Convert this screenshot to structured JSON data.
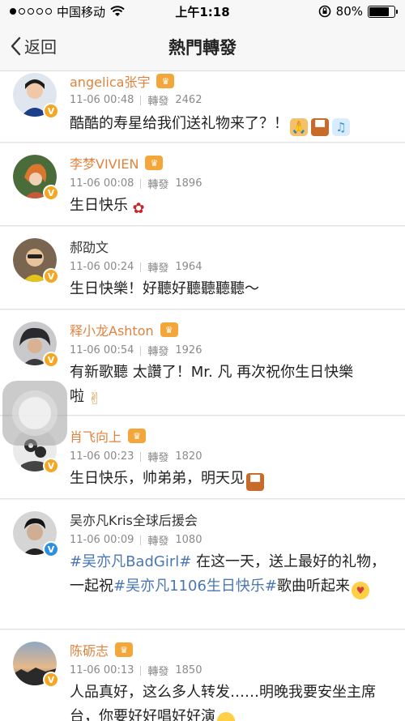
{
  "status_bar": {
    "carrier": "中国移动",
    "time": "上午1:18",
    "battery": "80%",
    "battery_level": 0.8
  },
  "nav": {
    "back_label": "返回",
    "title": "熱門轉發"
  },
  "reposts": [
    {
      "name": "angelica张宇",
      "date": "11-06 00:48",
      "repost_label": "轉發",
      "count": "2462",
      "member": true,
      "text": "酷酷的寿星给我们送礼物来了？！",
      "emojis": [
        "pray-emoji",
        "cake-emoji",
        "music-note-emoji"
      ]
    },
    {
      "name": "李梦VIVIEN",
      "date": "11-06 00:08",
      "repost_label": "轉發",
      "count": "1896",
      "member": true,
      "text": "生日快乐",
      "emojis": [
        "rose-emoji"
      ]
    },
    {
      "name": "郝劭文",
      "date": "11-06 00:24",
      "repost_label": "轉發",
      "count": "1964",
      "member": false,
      "text": "生日快樂！好聽好聽聽聽聽～",
      "emojis": []
    },
    {
      "name": "释小龙Ashton",
      "date": "11-06 00:54",
      "repost_label": "轉發",
      "count": "1926",
      "member": true,
      "text_line1": "有新歌聽 太讚了！Mr. 凡 再次祝你生日快樂",
      "text_line2": "啦",
      "emojis": [
        "victory-hand-emoji"
      ]
    },
    {
      "name": "肖飞向上",
      "date": "11-06 00:23",
      "repost_label": "轉發",
      "count": "1820",
      "member": true,
      "text": "生日快乐，帅弟弟，明天见",
      "emojis": [
        "cake-emoji"
      ]
    },
    {
      "name": "吴亦凡Kris全球后援会",
      "date": "11-06 00:09",
      "repost_label": "轉發",
      "count": "1080",
      "member": false,
      "hashtag1": "#吴亦凡BadGirl#",
      "text_a": " 在这一天，送上最好的礼物，一起祝",
      "hashtag2": "#吴亦凡1106生日快乐#",
      "text_b": "歌曲听起来",
      "emojis": [
        "blow-kiss-emoji"
      ]
    },
    {
      "name": "陈砺志",
      "date": "11-06 00:13",
      "repost_label": "轉發",
      "count": "1850",
      "member": true,
      "text": "人品真好，这么多人转发……明晚我要安坐主席台，你要好好唱好好演",
      "emojis": [
        "smirk-face-emoji"
      ]
    }
  ],
  "colors": {
    "name_orange": "#e0833f",
    "hashtag_blue": "#4a77b4",
    "verified_orange": "#f5a623",
    "verified_blue": "#2d8fe0"
  }
}
